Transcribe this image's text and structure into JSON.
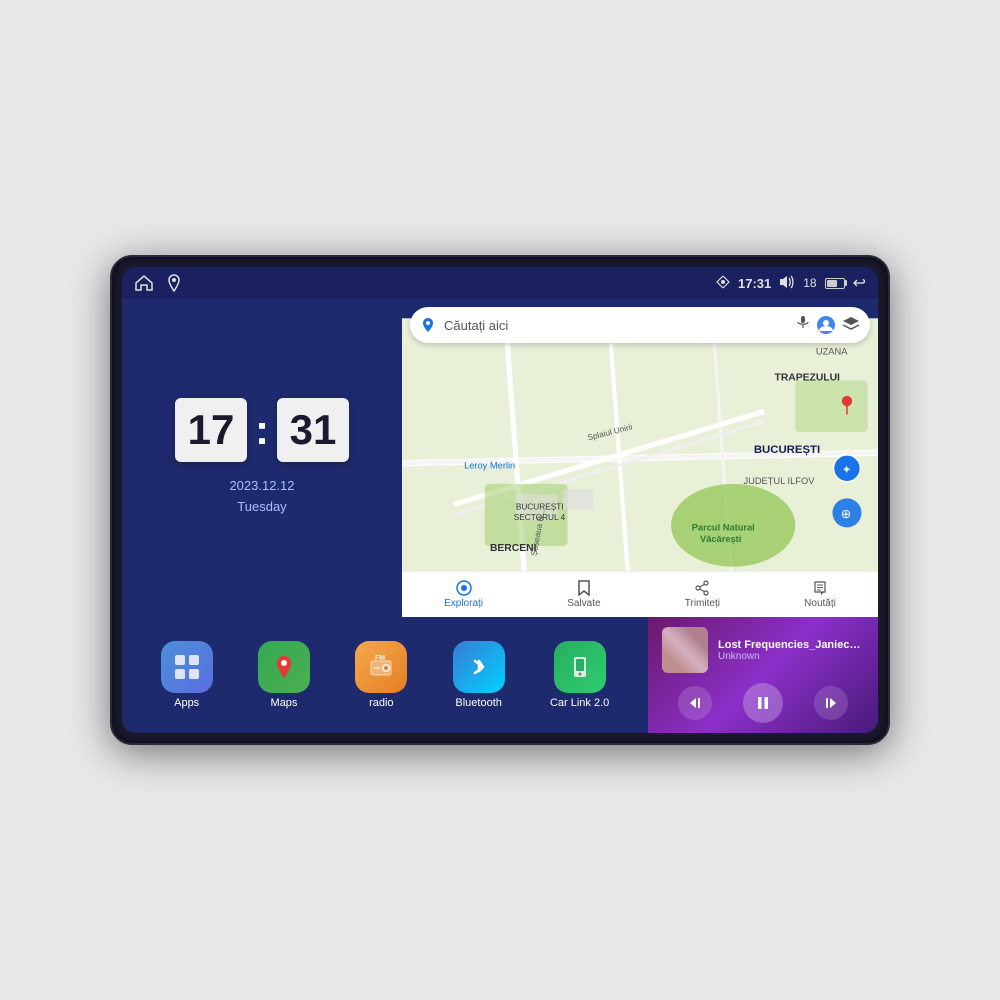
{
  "device": {
    "status_bar": {
      "time": "17:31",
      "signal": "▽",
      "volume": "🔊",
      "battery_level": "18",
      "back_label": "↩"
    },
    "clock": {
      "hour": "17",
      "minute": "31",
      "date": "2023.12.12",
      "day": "Tuesday"
    },
    "map": {
      "search_placeholder": "Căutați aici",
      "nav_items": [
        {
          "label": "Explorați",
          "active": true
        },
        {
          "label": "Salvate",
          "active": false
        },
        {
          "label": "Trimiteți",
          "active": false
        },
        {
          "label": "Noutăți",
          "active": false
        }
      ],
      "labels": [
        "TRAPEZULUI",
        "BUCUREȘTI",
        "JUDEȚUL ILFOV",
        "BERCENI",
        "Parcul Natural Văcărești",
        "Leroy Merlin",
        "BUCUREȘTI SECTORUL 4",
        "Splaiul Unirii"
      ]
    },
    "apps": [
      {
        "id": "apps",
        "label": "Apps",
        "icon_class": "icon-apps",
        "symbol": "⊞"
      },
      {
        "id": "maps",
        "label": "Maps",
        "icon_class": "icon-maps",
        "symbol": "📍"
      },
      {
        "id": "radio",
        "label": "radio",
        "icon_class": "icon-radio",
        "symbol": "📻"
      },
      {
        "id": "bluetooth",
        "label": "Bluetooth",
        "icon_class": "icon-bluetooth",
        "symbol": "₿"
      },
      {
        "id": "carlink",
        "label": "Car Link 2.0",
        "icon_class": "icon-carlink",
        "symbol": "📱"
      }
    ],
    "music": {
      "title": "Lost Frequencies_Janieck Devy-...",
      "artist": "Unknown",
      "controls": {
        "prev": "⏮",
        "play": "⏸",
        "next": "⏭"
      }
    }
  }
}
